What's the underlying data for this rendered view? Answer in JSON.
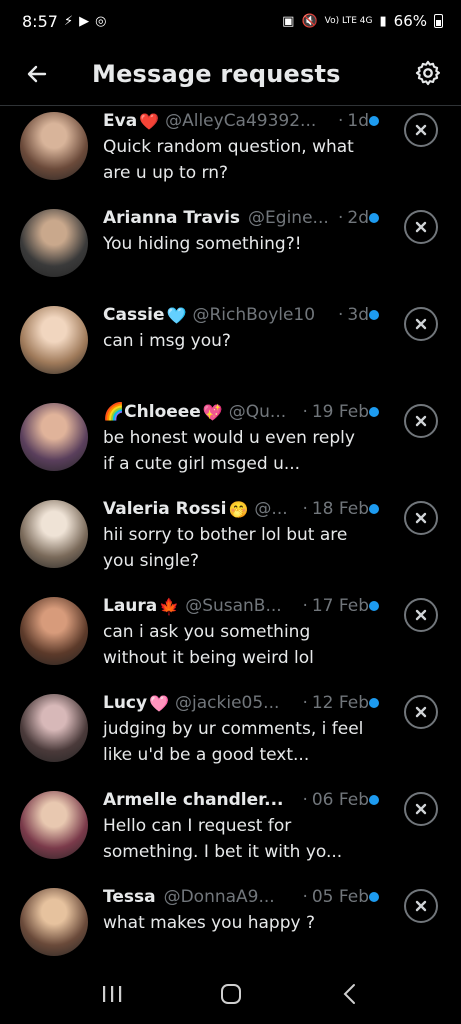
{
  "status": {
    "time": "8:57",
    "network_label": "Vo) LTE 4G",
    "battery": "66%"
  },
  "header": {
    "title": "Message requests",
    "back_icon": "arrow-left-icon",
    "settings_icon": "gear-icon"
  },
  "colors": {
    "background": "#000000",
    "text": "#e7e9ea",
    "muted": "#71767b",
    "accent": "#1d9bf0"
  },
  "requests": [
    {
      "name": "Eva",
      "emoji": "❤️",
      "handle": "@AlleyCa49392...",
      "time": "1d",
      "message": "Quick random question, what are u up to rn?",
      "unread": true
    },
    {
      "name": "Arianna Travis",
      "emoji": "",
      "handle": "@Egine...",
      "time": "2d",
      "message": "You hiding something?!",
      "unread": true
    },
    {
      "name": "Cassie",
      "emoji": "🩵",
      "handle": "@RichBoyle10",
      "time": "3d",
      "message": "can i msg you?",
      "unread": true
    },
    {
      "name": "🌈Chloeee",
      "emoji": "💖",
      "handle": "@Qu...",
      "time": "19 Feb",
      "message": "be honest would u even reply if a cute girl msged u...",
      "unread": true
    },
    {
      "name": "Valeria Rossi",
      "emoji": "🤭",
      "handle": "@...",
      "time": "18 Feb",
      "message": "hii sorry to bother lol but are you single?",
      "unread": true
    },
    {
      "name": "Laura",
      "emoji": "🍁",
      "handle": "@SusanB...",
      "time": "17 Feb",
      "message": "can i ask you something without it being weird lol",
      "unread": true
    },
    {
      "name": "Lucy",
      "emoji": "🩷",
      "handle": "@jackie05...",
      "time": "12 Feb",
      "message": "judging by ur comments, i feel like u'd be a good text...",
      "unread": true
    },
    {
      "name": "Armelle chandler...",
      "emoji": "",
      "handle": "",
      "time": "06 Feb",
      "message": "Hello can I request for something. I bet it with yo...",
      "unread": true
    },
    {
      "name": "Tessa",
      "emoji": "",
      "handle": "@DonnaA9...",
      "time": "05 Feb",
      "message": "what makes you happy ?",
      "unread": true
    }
  ]
}
